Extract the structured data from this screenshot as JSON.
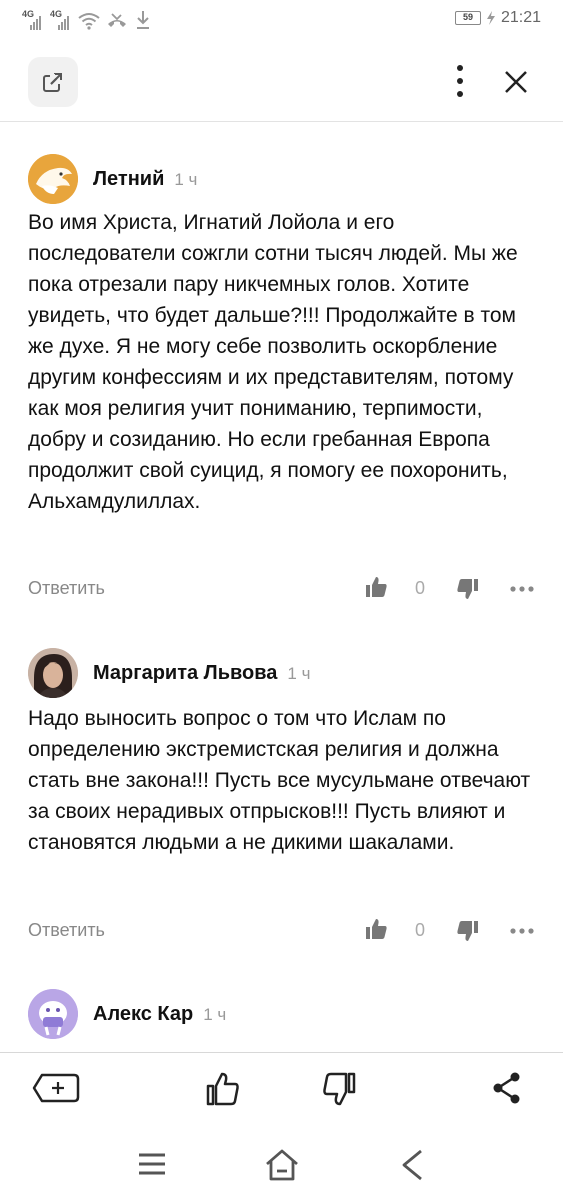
{
  "status_bar": {
    "sim1_label": "4G",
    "sim2_label": "4G",
    "battery": "59",
    "time": "21:21"
  },
  "toolbar": {
    "icons": [
      "open-external-icon",
      "more-vertical-icon",
      "close-icon"
    ]
  },
  "comments": [
    {
      "author": "Летний",
      "time": "1 ч",
      "text": "Во имя Христа, Игнатий Лойола и его последователи сожгли сотни тысяч людей. Мы же пока отрезали пару никчемных голов. Хотите увидеть, что будет дальше?!!! Продолжайте в том же духе. Я не могу себе позволить оскорбление другим конфессиям и их представителям, потому как моя религия учит пониманию, терпимости, добру и созиданию. Но если гребанная Европа продолжит свой суицид, я помогу ее похоронить, Альхамдулиллах.",
      "reply_label": "Ответить",
      "likes": "0"
    },
    {
      "author": "Маргарита Львова",
      "time": "1 ч",
      "text": "Надо выносить вопрос о том что Ислам по определению экстремистская религия и должна стать вне закона!!! Пусть все мусульмане отвечают за своих нерадивых отпрысков!!! Пусть влияют и становятся людьми а не дикими шакалами.",
      "reply_label": "Ответить",
      "likes": "0"
    },
    {
      "author": "Алекс Кар",
      "time": "1 ч"
    }
  ],
  "bottom_bar": {
    "icons": [
      "add-comment-icon",
      "like-icon",
      "dislike-icon",
      "share-icon"
    ]
  },
  "system_nav": {
    "icons": [
      "menu-icon",
      "home-icon",
      "back-icon"
    ]
  },
  "colors": {
    "text": "#111111",
    "muted": "#888888",
    "icon": "#333333",
    "avatar_orange": "#e8a53c",
    "avatar_purple": "#b9a6e6"
  }
}
